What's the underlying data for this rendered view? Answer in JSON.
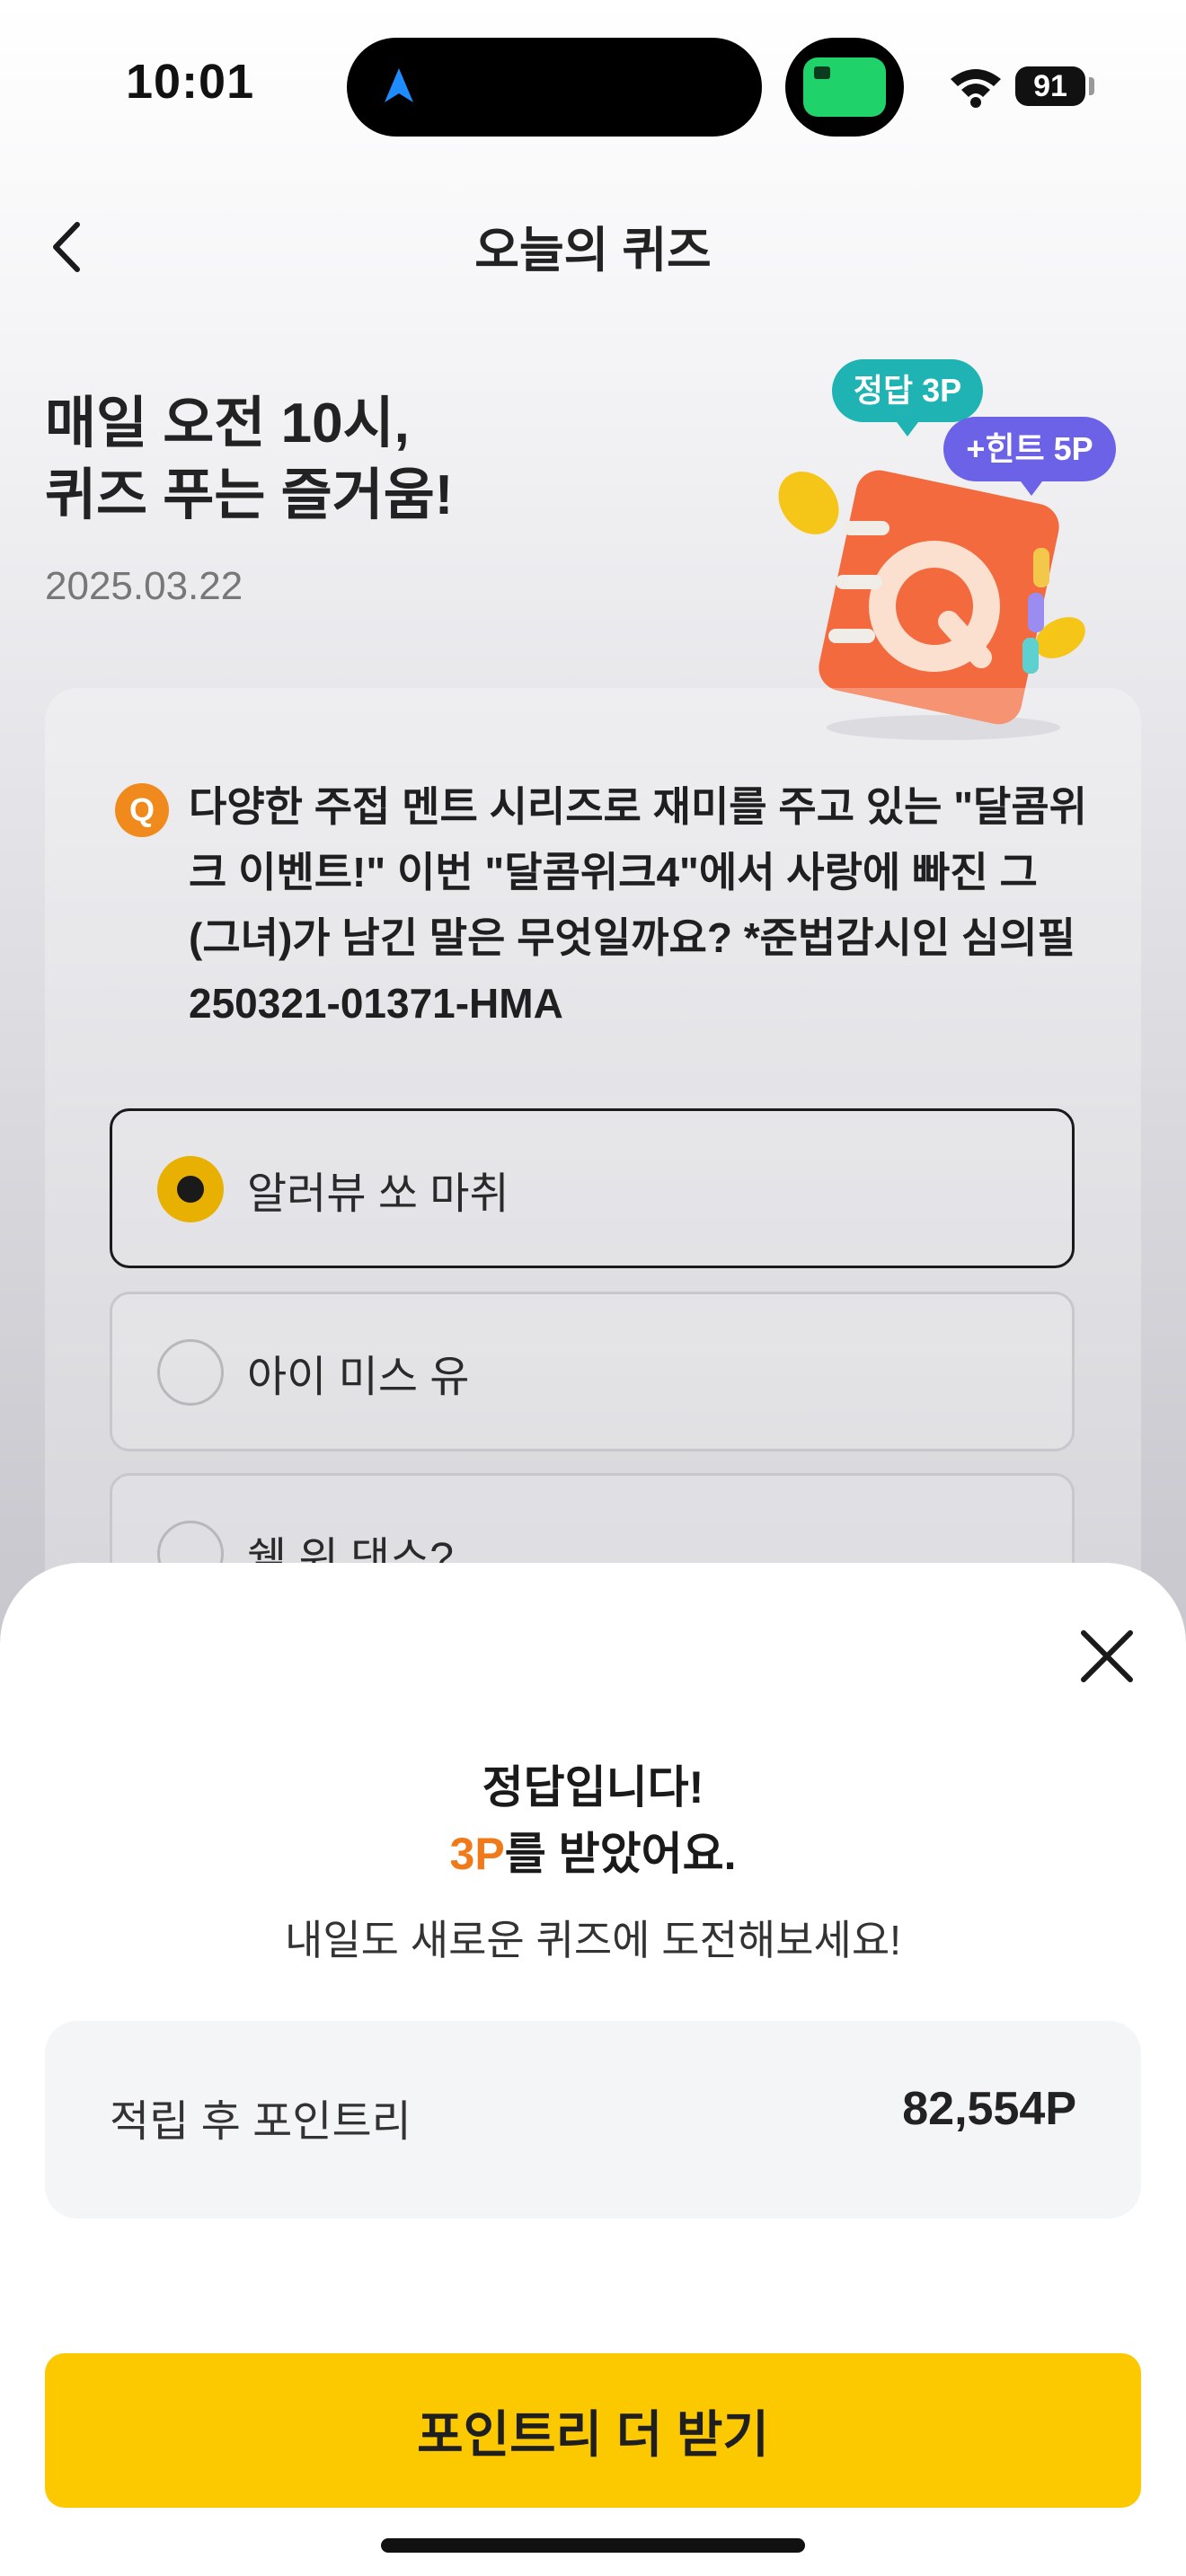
{
  "status_bar": {
    "time": "10:01",
    "battery": "91",
    "icons": [
      "navigation-arrow-icon",
      "live-activity-icon",
      "wifi-icon",
      "battery-icon"
    ]
  },
  "header": {
    "title": "오늘의 퀴즈",
    "back_icon": "chevron-left-icon"
  },
  "hero": {
    "title": "매일 오전 10시,\n퀴즈 푸는 즐거움!",
    "date": "2025.03.22",
    "badge_answer": "정답 3P",
    "badge_hint": "+힌트 5P",
    "illustration_letter": "Q"
  },
  "quiz": {
    "q_marker": "Q",
    "question": "다양한 주접 멘트 시리즈로 재미를 주고 있는 \"달콤위크 이벤트!\" 이번 \"달콤위크4\"에서 사랑에 빠진 그(그녀)가 남긴 말은 무엇일까요? *준법감시인 심의필250321-01371-HMA",
    "options": [
      {
        "label": "알러뷰 쏘 마취",
        "selected": true
      },
      {
        "label": "아이 미스 유",
        "selected": false
      },
      {
        "label": "쉘 위 댄스?",
        "selected": false
      }
    ]
  },
  "result_sheet": {
    "close_icon": "close-icon",
    "line1": "정답입니다!",
    "points_earned": "3P",
    "line2_suffix": "를 받았어요.",
    "subtitle": "내일도 새로운 퀴즈에 도전해보세요!",
    "points_label": "적립 후 포인트리",
    "points_value": "82,554P",
    "cta_label": "포인트리 더 받기"
  },
  "colors": {
    "accent_orange": "#f07a1a",
    "cta_yellow": "#fcc900",
    "badge_teal": "#1fb3b3",
    "badge_purple": "#6b62e8"
  }
}
